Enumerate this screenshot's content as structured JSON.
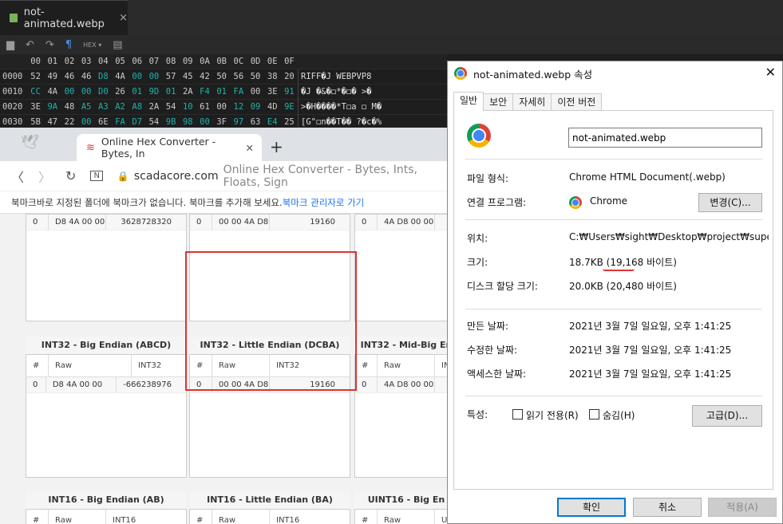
{
  "editor": {
    "tab_title": "not-animated.webp",
    "tab_close": "×",
    "toolbar": {
      "hex_label": "HEX",
      "pilcrow": "¶"
    },
    "header_cols": [
      "00",
      "01",
      "02",
      "03",
      "04",
      "05",
      "06",
      "07",
      "08",
      "09",
      "0A",
      "0B",
      "0C",
      "0D",
      "0E",
      "0F"
    ],
    "rows": [
      {
        "offset": "0000",
        "bytes": [
          "52",
          "49",
          "46",
          "46",
          "D8",
          "4A",
          "00",
          "00",
          "57",
          "45",
          "42",
          "50",
          "56",
          "50",
          "38",
          "20"
        ],
        "ascii": "RIFF�J  WEBPVP8"
      },
      {
        "offset": "0010",
        "bytes": [
          "CC",
          "4A",
          "00",
          "00",
          "D0",
          "26",
          "01",
          "9D",
          "01",
          "2A",
          "F4",
          "01",
          "FA",
          "00",
          "3E",
          "91"
        ],
        "ascii": "�J  �&�◻*�◻� >�"
      },
      {
        "offset": "0020",
        "bytes": [
          "3E",
          "9A",
          "48",
          "A5",
          "A3",
          "A2",
          "A8",
          "2A",
          "54",
          "10",
          "61",
          "00",
          "12",
          "09",
          "4D",
          "9E"
        ],
        "ascii": ">�H����*T◻a ◻ M�"
      },
      {
        "offset": "0030",
        "bytes": [
          "5B",
          "47",
          "22",
          "00",
          "6E",
          "FA",
          "D7",
          "54",
          "9B",
          "98",
          "00",
          "3F",
          "97",
          "63",
          "E4",
          "25"
        ],
        "ascii": "[G\"◻n��T�� ?�c�%"
      }
    ]
  },
  "browser": {
    "tab_title": "Online Hex Converter - Bytes, In",
    "tab_close": "✕",
    "new_tab": "+",
    "url_domain": "scadacore.com",
    "url_rest": "Online Hex Converter - Bytes, Ints, Floats, Sign",
    "bookmark_text": "북마크바로 지정된 폴더에 북마크가 없습니다. 북마크를 추가해 보세요.",
    "bookmark_link": "북마크 관리자로 가기"
  },
  "panels_top": [
    {
      "row": {
        "n": "0",
        "raw": "D8 4A 00 00",
        "val": "3628728320"
      }
    },
    {
      "row": {
        "n": "0",
        "raw": "00 00 4A D8",
        "val": "19160"
      }
    },
    {
      "row": {
        "n": "0",
        "raw": "4A D8 00 00",
        "val": ""
      }
    }
  ],
  "panels_mid": [
    {
      "title": "INT32 - Big Endian (ABCD)",
      "h1": "#",
      "h2": "Raw",
      "h3": "INT32",
      "row": {
        "n": "0",
        "raw": "D8 4A 00 00",
        "val": "-666238976"
      }
    },
    {
      "title": "INT32 - Little Endian (DCBA)",
      "h1": "#",
      "h2": "Raw",
      "h3": "INT32",
      "row": {
        "n": "0",
        "raw": "00 00 4A D8",
        "val": "19160"
      }
    },
    {
      "title": "INT32 - Mid-Big En",
      "h1": "#",
      "h2": "Raw",
      "h3": "IN",
      "row": {
        "n": "0",
        "raw": "4A D8 00 00",
        "val": ""
      }
    }
  ],
  "panels_bottom": [
    {
      "title": "INT16 - Big Endian (AB)",
      "h1": "#",
      "h2": "Raw",
      "h3": "INT16"
    },
    {
      "title": "INT16 - Little Endian (BA)",
      "h1": "#",
      "h2": "Raw",
      "h3": "INT16"
    },
    {
      "title": "UINT16 - Big En",
      "h1": "#",
      "h2": "Raw",
      "h3": "UI"
    }
  ],
  "dialog": {
    "title": "not-animated.webp 속성",
    "close": "✕",
    "tabs": [
      "일반",
      "보안",
      "자세히",
      "이전 버전"
    ],
    "filename": "not-animated.webp",
    "file_type_label": "파일 형식:",
    "file_type_value": "Chrome HTML Document(.webp)",
    "open_with_label": "연결 프로그램:",
    "open_with_value": "Chrome",
    "change_button": "변경(C)...",
    "location_label": "위치:",
    "location_value": "C:₩Users₩sight₩Desktop₩project₩super-inv",
    "size_label": "크기:",
    "size_value": "18.7KB (19,168 바이트)",
    "disk_label": "디스크 할당 크기:",
    "disk_value": "20.0KB (20,480 바이트)",
    "created_label": "만든 날짜:",
    "created_value": "2021년 3월 7일 일요일, 오후 1:41:25",
    "modified_label": "수정한 날짜:",
    "modified_value": "2021년 3월 7일 일요일, 오후 1:41:25",
    "accessed_label": "액세스한 날짜:",
    "accessed_value": "2021년 3월 7일 일요일, 오후 1:41:25",
    "attr_label": "특성:",
    "readonly_label": "읽기 전용(R)",
    "hidden_label": "숨김(H)",
    "advanced_button": "고급(D)...",
    "ok_button": "확인",
    "cancel_button": "취소",
    "apply_button": "적용(A)"
  }
}
